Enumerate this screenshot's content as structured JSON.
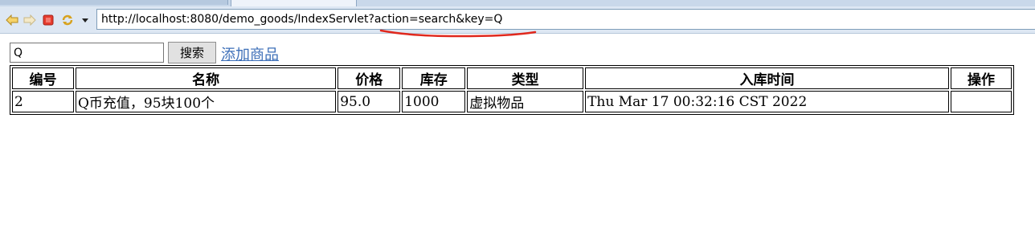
{
  "browser": {
    "url": "http://localhost:8080/demo_goods/IndexServlet?action=search&key=Q",
    "nav_icons": [
      "back-icon",
      "forward-icon",
      "stop-icon",
      "refresh-icon",
      "dropdown-arrow-icon"
    ]
  },
  "search": {
    "value": "Q",
    "button_label": "搜索"
  },
  "add_link": "添加商品",
  "table": {
    "headers": [
      "编号",
      "名称",
      "价格",
      "库存",
      "类型",
      "入库时间",
      "操作"
    ],
    "rows": [
      [
        "2",
        "Q币充值，95块100个",
        "95.0",
        "1000",
        "虚拟物品",
        "Thu Mar 17 00:32:16 CST 2022",
        ""
      ]
    ]
  },
  "colors": {
    "annotation": "#e0281d",
    "link": "#3d6fb8",
    "toolbar": "#dde7f3"
  }
}
